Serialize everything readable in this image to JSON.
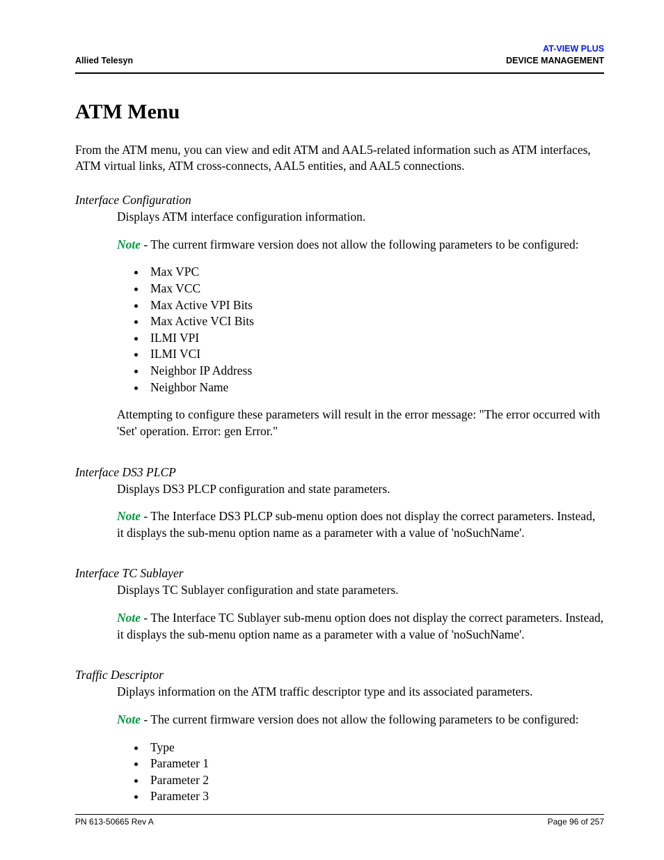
{
  "header": {
    "left": "Allied Telesyn",
    "rightProduct": "AT-VIEW PLUS",
    "rightLine2": "DEVICE MANAGEMENT"
  },
  "title": "ATM Menu",
  "intro": "From the ATM menu, you can view and edit ATM and AAL5-related information such as ATM interfaces, ATM virtual links, ATM cross-connects, AAL5 entities, and AAL5 connections.",
  "noteLabel": "Note",
  "sections": {
    "ifConfig": {
      "title": "Interface Configuration",
      "desc": "Displays ATM interface configuration information.",
      "noteText": " - The current firmware version does not allow the following parameters to be configured:",
      "params": [
        "Max VPC",
        "Max VCC",
        "Max Active VPI Bits",
        "Max Active VCI Bits",
        "ILMI VPI",
        "ILMI VCI",
        "Neighbor IP Address",
        "Neighbor Name"
      ],
      "trailer": "Attempting to configure these parameters will result in the error message: \"The error occurred with 'Set' operation. Error: gen Error.\""
    },
    "ds3": {
      "title": " Interface DS3 PLCP",
      "desc": "Displays DS3 PLCP configuration and state parameters.",
      "noteText": " - The Interface DS3 PLCP sub-menu option does not display the correct parameters. Instead, it displays the sub-menu option name as a parameter with a value of 'noSuchName'."
    },
    "tc": {
      "title": "Interface TC Sublayer",
      "desc": "Displays TC Sublayer configuration and state parameters.",
      "noteText": " - The Interface TC Sublayer sub-menu option does not display the correct parameters. Instead, it displays the sub-menu option name as a parameter with a value of 'noSuchName'."
    },
    "traffic": {
      "title": "Traffic Descriptor",
      "desc": "Diplays information on the ATM traffic descriptor type and its associated parameters.",
      "noteText": " - The current firmware version does not allow the following parameters to be configured:",
      "params": [
        "Type",
        "Parameter 1",
        "Parameter 2",
        "Parameter 3"
      ]
    }
  },
  "footer": {
    "left": "PN 613-50665 Rev A",
    "right": "Page 96 of 257"
  }
}
